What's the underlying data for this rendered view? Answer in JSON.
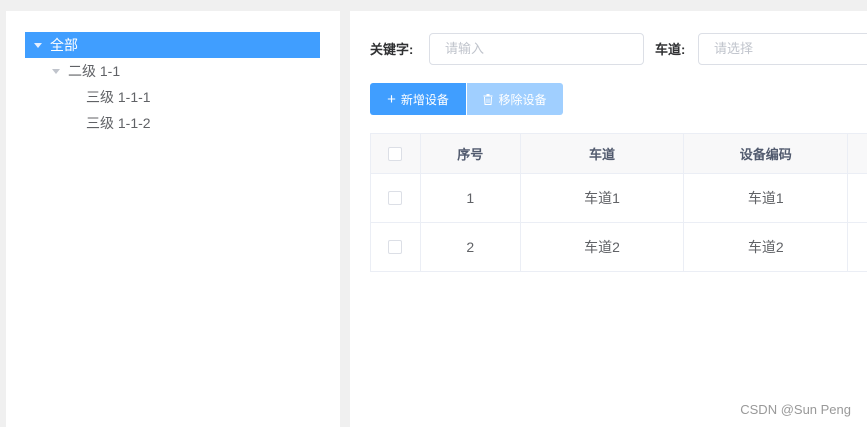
{
  "tree": {
    "root": "全部",
    "level2": "二级 1-1",
    "level3": [
      "三级 1-1-1",
      "三级 1-1-2"
    ]
  },
  "search": {
    "keyword_label": "关键字:",
    "keyword_placeholder": "请输入",
    "lane_label": "车道:",
    "lane_placeholder": "请选择"
  },
  "toolbar": {
    "add_label": "新增设备",
    "remove_label": "移除设备"
  },
  "table": {
    "headers": [
      "序号",
      "车道",
      "设备编码"
    ],
    "rows": [
      [
        "1",
        "车道1",
        "车道1"
      ],
      [
        "2",
        "车道2",
        "车道2"
      ]
    ]
  },
  "watermark": "CSDN @Sun  Peng",
  "colors": {
    "primary": "#409eff",
    "primary_disabled": "#a0cfff"
  }
}
